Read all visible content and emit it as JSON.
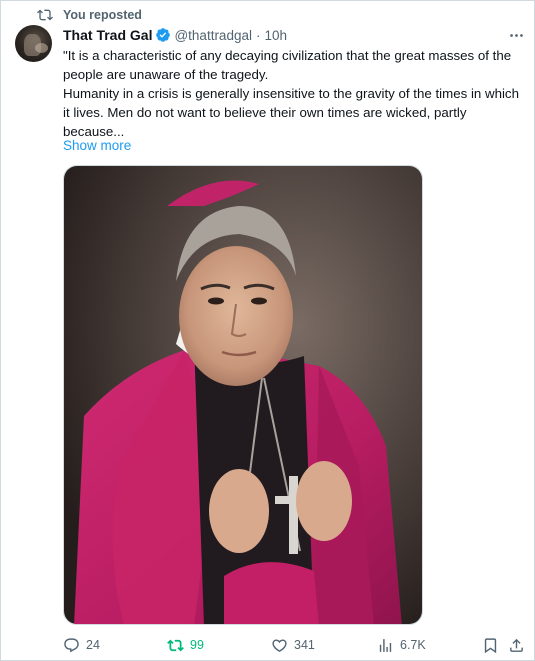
{
  "repost_banner": {
    "text": "You reposted"
  },
  "post": {
    "author_name": "That Trad Gal",
    "handle": "@thattradgal",
    "separator": "·",
    "time": "10h",
    "text_lines": [
      "\"It is a characteristic of any decaying civilization that the great masses of the people are unaware of the tragedy.",
      "Humanity in a crisis is generally insensitive to the gravity of the times in which it lives. Men do not want to believe their own times are wicked, partly because..."
    ],
    "show_more": "Show more",
    "actions": {
      "replies": "24",
      "reposts": "99",
      "likes": "341",
      "views": "6.7K"
    }
  },
  "colors": {
    "accent": "#1d9bf0",
    "retweet_active": "#00ba7c",
    "secondary_text": "#536471",
    "robe_magenta": "#c4226a"
  },
  "icons": [
    "repost-icon",
    "verified-badge-icon",
    "more-options-icon",
    "reply-icon",
    "retweet-icon",
    "like-icon",
    "views-icon",
    "bookmark-icon",
    "share-icon"
  ]
}
